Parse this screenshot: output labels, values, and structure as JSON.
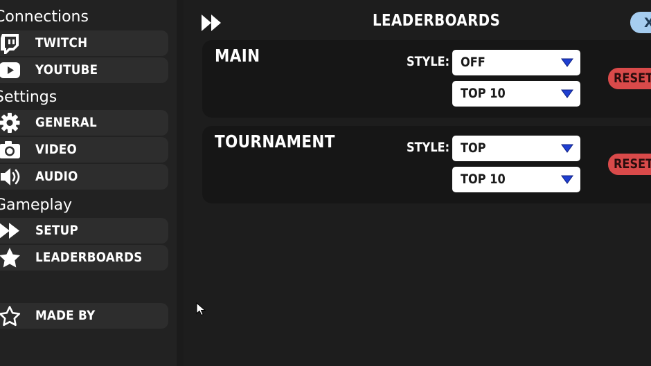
{
  "sidebar": {
    "sections": [
      {
        "title": "Connections",
        "items": [
          {
            "label": "TWITCH",
            "icon": "twitch-icon"
          },
          {
            "label": "YOUTUBE",
            "icon": "youtube-icon"
          }
        ]
      },
      {
        "title": "Settings",
        "items": [
          {
            "label": "GENERAL",
            "icon": "gear-icon"
          },
          {
            "label": "VIDEO",
            "icon": "camera-icon"
          },
          {
            "label": "AUDIO",
            "icon": "speaker-icon"
          }
        ]
      },
      {
        "title": "Gameplay",
        "items": [
          {
            "label": "SETUP",
            "icon": "fast-forward-icon"
          },
          {
            "label": "LEADERBOARDS",
            "icon": "star-icon"
          }
        ]
      }
    ],
    "footer_item": {
      "label": "MADE BY",
      "icon": "star-outline-icon"
    }
  },
  "header": {
    "title": "LEADERBOARDS",
    "icon": "fast-forward-icon",
    "close_label": "X",
    "close_color": "#a6cdf0"
  },
  "cards": [
    {
      "title": "MAIN",
      "style_label": "STYLE:",
      "style_value": "OFF",
      "count_value": "TOP 10",
      "reset_label": "RESET"
    },
    {
      "title": "TOURNAMENT",
      "style_label": "STYLE:",
      "style_value": "TOP",
      "count_value": "TOP 10",
      "reset_label": "RESET"
    }
  ],
  "colors": {
    "reset": "#d94a4a",
    "dropdown_arrow": "#1f3fd1",
    "nav_item_bg": "#2d2d2d"
  }
}
